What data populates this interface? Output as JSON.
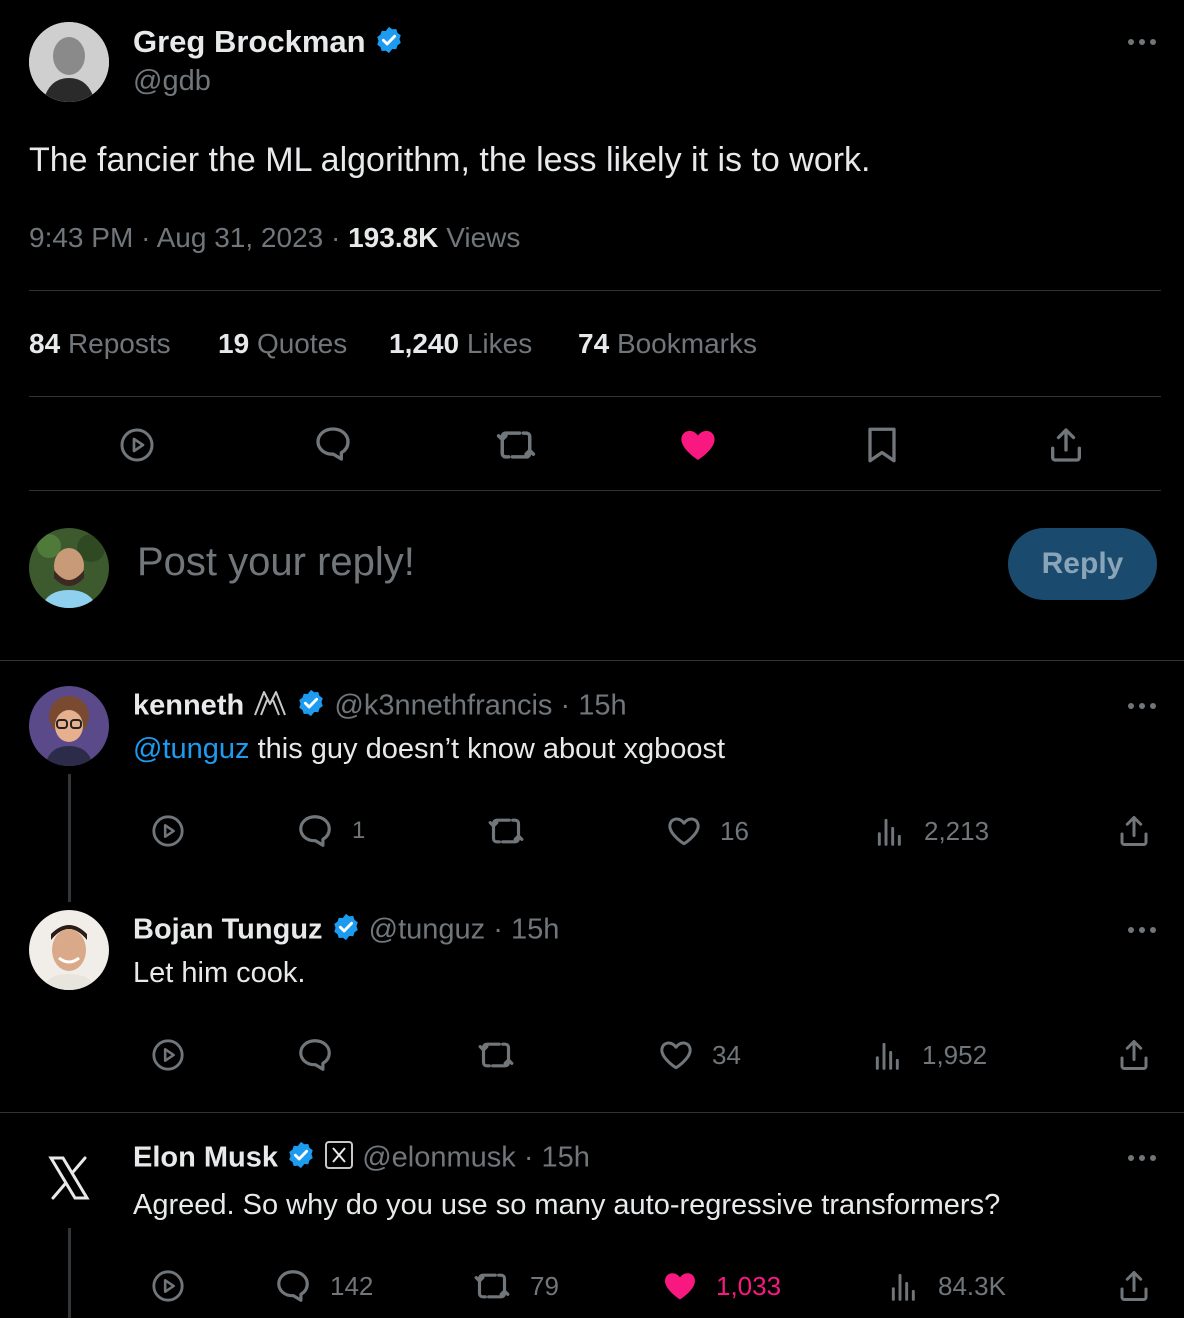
{
  "main_post": {
    "author_name": "Greg Brockman",
    "handle": "@gdb",
    "text": "The fancier the ML algorithm, the less likely it is to work.",
    "time": "9:43 PM",
    "separator": "·",
    "date": "Aug 31, 2023",
    "views_count": "193.8K",
    "views_label": "Views",
    "stats": [
      {
        "count": "84",
        "label": "Reposts"
      },
      {
        "count": "19",
        "label": "Quotes"
      },
      {
        "count": "1,240",
        "label": "Likes"
      },
      {
        "count": "74",
        "label": "Bookmarks"
      }
    ],
    "actions": [
      "views-icon",
      "reply-icon",
      "repost-icon",
      "heart-filled-icon",
      "bookmark-icon",
      "share-icon"
    ]
  },
  "composer": {
    "placeholder": "Post your reply!",
    "reply_button": "Reply"
  },
  "replies": [
    {
      "name": "kenneth",
      "handle": "@k3nnethfrancis",
      "time": "· 15h",
      "mention": "@tunguz",
      "text": " this guy doesn’t know about xgboost",
      "replies": "1",
      "reposts": "",
      "likes": "16",
      "views": "2,213",
      "liked": false
    },
    {
      "name": "Bojan Tunguz",
      "handle": "@tunguz",
      "time": "· 15h",
      "text": "Let him cook.",
      "replies": "",
      "reposts": "",
      "likes": "34",
      "views": "1,952",
      "liked": false
    },
    {
      "name": "Elon Musk",
      "handle": "@elonmusk",
      "time": "· 15h",
      "text": "Agreed. So why do you use so many auto-regressive transformers?",
      "replies": "142",
      "reposts": "79",
      "likes": "1,033",
      "views": "84.3K",
      "liked": true
    }
  ],
  "colors": {
    "accent": "#1d9bf0",
    "like": "#f91880",
    "reply_button_bg": "#1a4a6e",
    "reply_button_text": "#8aa5b8"
  }
}
